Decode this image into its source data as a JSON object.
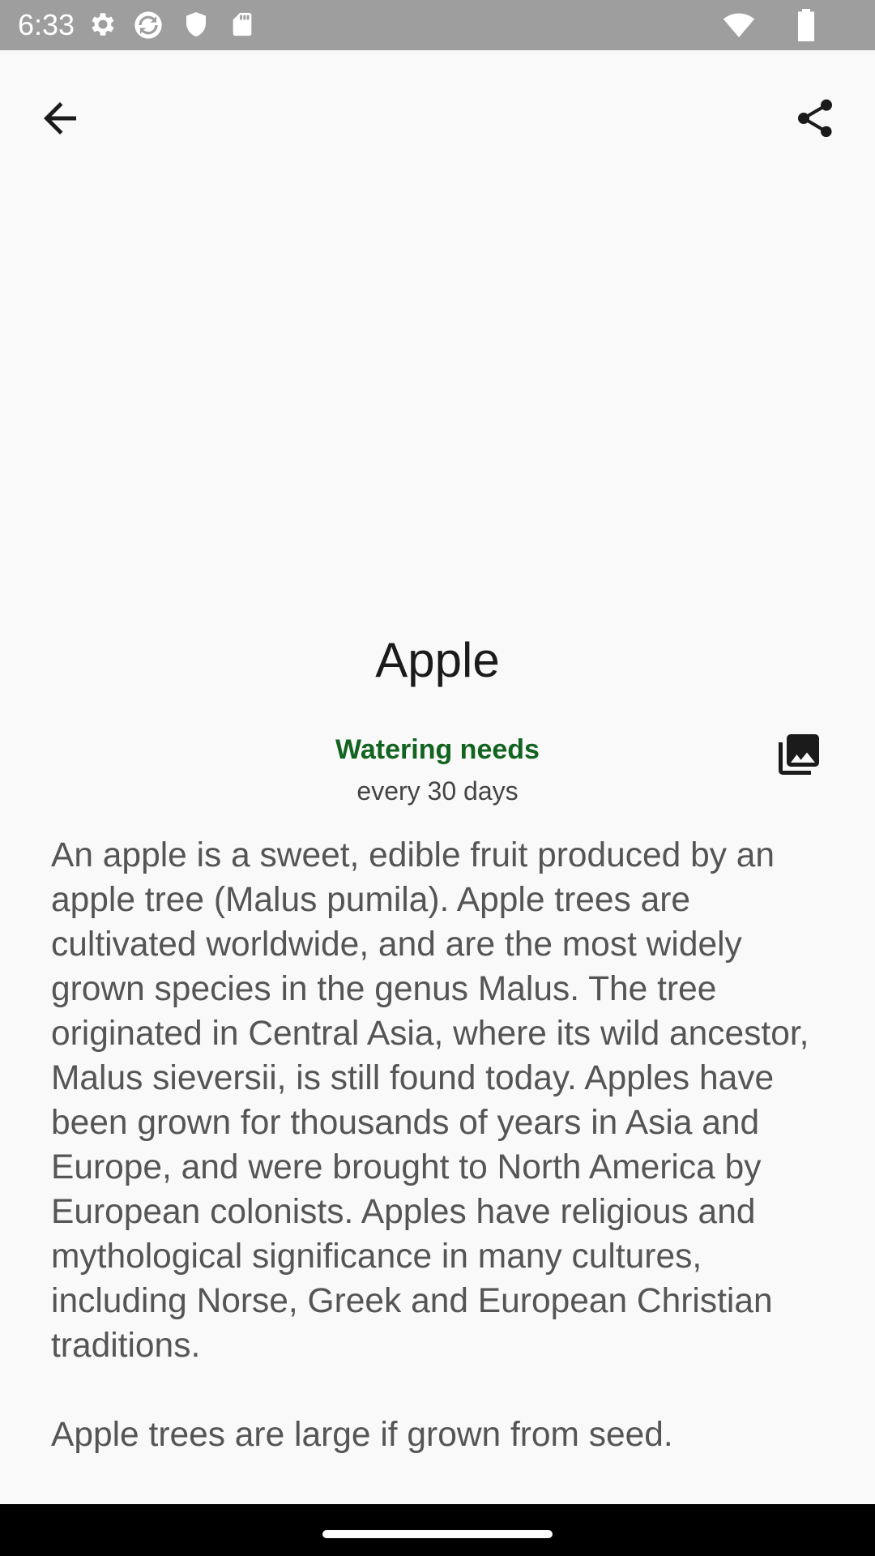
{
  "status_bar": {
    "time": "6:33",
    "icons": [
      "settings-icon",
      "sync-icon",
      "shield-icon",
      "sd-card-icon",
      "wifi-icon",
      "battery-icon"
    ]
  },
  "app_bar": {
    "back_icon": "arrow-back-icon",
    "share_icon": "share-icon"
  },
  "plant": {
    "name": "Apple",
    "watering_title": "Watering needs",
    "watering_value": "every 30 days",
    "gallery_icon": "photo-library-icon",
    "description": "An apple is a sweet, edible fruit produced by an apple tree (Malus pumila). Apple trees are cultivated worldwide, and are the most widely grown species in the genus Malus. The tree originated in Central Asia, where its wild ancestor, Malus sieversii, is still found today. Apples have been grown for thousands of years in Asia and Europe, and were brought to North America by European colonists. Apples have religious and mythological significance in many cultures, including Norse, Greek and European Christian traditions.\n\nApple trees are large if grown from seed."
  },
  "colors": {
    "background": "#f8f9f8",
    "accent_green": "#11631f",
    "status_bar": "#9e9e9e",
    "nav_bar": "#000000"
  }
}
